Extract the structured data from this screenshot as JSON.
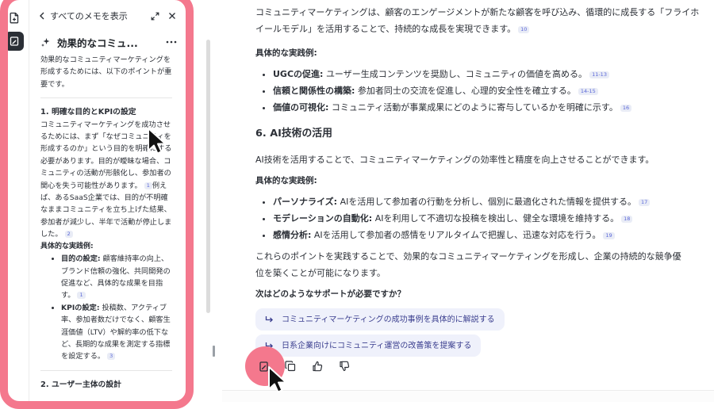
{
  "rail": {
    "icons": [
      "new-note-icon",
      "notes-panel-icon"
    ]
  },
  "notes_panel": {
    "back_label": "すべてのメモを表示",
    "title": "効果的なコミュ...",
    "intro": "効果的なコミュニティマーケティングを形成するためには、以下のポイントが重要です。",
    "section1_heading": "1. 明確な目的とKPIの設定",
    "section1_text": "コミュニティマーケティングを成功させるためには、まず「なぜコミュニティを形成するのか」という目的を明確にする必要があります。目的が曖昧な場合、コミュニティの活動が形骸化し、参加者の関心を失う可能性があります。",
    "section1_cite1": "1",
    "section1_text2": "例えば、あるSaaS企業では、目的が不明確なままコミュニティを立ち上げた結果、参加者が減少し、半年で活動が停止しました。",
    "section1_cite2": "2",
    "practice_heading": "具体的な実践例:",
    "list": [
      {
        "label": "目的の設定:",
        "text": "顧客維持率の向上、ブランド信頼の強化、共同開発の促進など、具体的な成果を目指す。",
        "cite": "1"
      },
      {
        "label": "KPIの設定:",
        "text": "投稿数、アクティブ率、参加者数だけでなく、顧客生涯価値（LTV）や解約率の低下など、長期的な成果を測定する指標を設定する。",
        "cite": "3"
      }
    ],
    "section2_heading": "2. ユーザー主体の設計"
  },
  "main": {
    "intro": "コミュニティマーケティングは、顧客のエンゲージメントが新たな顧客を呼び込み、循環的に成長する「フライホイールモデル」を活用することで、持続的な成長を実現できます。",
    "intro_cite": "10",
    "practice_heading1": "具体的な実践例:",
    "bullets1": [
      {
        "label": "UGCの促進:",
        "text": "ユーザー生成コンテンツを奨励し、コミュニティの価値を高める。",
        "cite": "11-13"
      },
      {
        "label": "信頼と関係性の構築:",
        "text": "参加者同士の交流を促進し、心理的安全性を確立する。",
        "cite": "14-15"
      },
      {
        "label": "価値の可視化:",
        "text": "コミュニティ活動が事業成果にどのように寄与しているかを明確に示す。",
        "cite": "16"
      }
    ],
    "section6_heading": "6. AI技術の活用",
    "section6_text": "AI技術を活用することで、コミュニティマーケティングの効率性と精度を向上させることができます。",
    "practice_heading2": "具体的な実践例:",
    "bullets2": [
      {
        "label": "パーソナライズ:",
        "text": "AIを活用して参加者の行動を分析し、個別に最適化された情報を提供する。",
        "cite": "17"
      },
      {
        "label": "モデレーションの自動化:",
        "text": "AIを利用して不適切な投稿を検出し、健全な環境を維持する。",
        "cite": "18"
      },
      {
        "label": "感情分析:",
        "text": "AIを活用して参加者の感情をリアルタイムで把握し、迅速な対応を行う。",
        "cite": "19"
      }
    ],
    "conclusion": "これらのポイントを実践することで、効果的なコミュニティマーケティングを形成し、企業の持続的な競争優位を築くことが可能になります。",
    "next_question": "次はどのようなサポートが必要ですか？",
    "suggestions": [
      "コミュニティマーケティングの成功事例を具体的に解説する",
      "日系企業向けにコミュニティ運営の改善策を提案する"
    ]
  },
  "actions": {
    "icons": [
      "save-to-notes-icon",
      "copy-icon",
      "thumbs-up-icon",
      "thumbs-down-icon"
    ]
  },
  "colors": {
    "highlight": "#f4788d",
    "cite_bg": "#e9ecf6",
    "cite_text": "#5a67d8",
    "suggest_bg": "#eff1fb",
    "suggest_text": "#3b3f8f",
    "rail_active": "#2b2f36"
  }
}
